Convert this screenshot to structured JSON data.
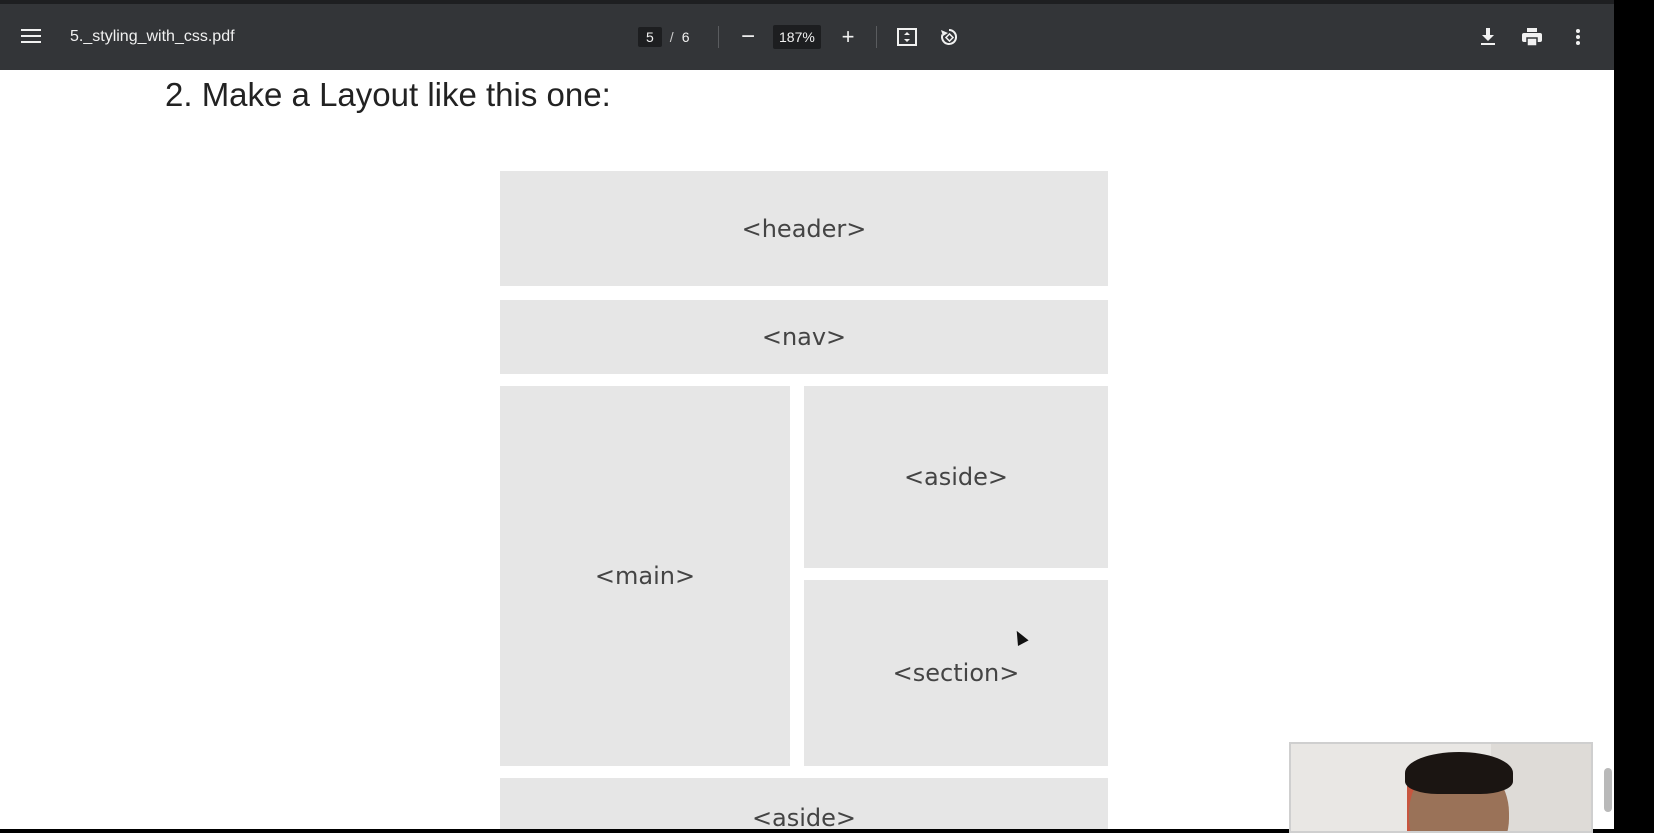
{
  "toolbar": {
    "file_name": "5._styling_with_css.pdf",
    "current_page": "5",
    "page_separator": "/",
    "total_pages": "6",
    "zoom_out_label": "−",
    "zoom_level": "187%",
    "zoom_in_label": "+",
    "icons": [
      "menu-icon",
      "fit-page-icon",
      "rotate-icon",
      "download-icon",
      "print-icon",
      "more-icon"
    ]
  },
  "document": {
    "heading": "2.  Make a Layout like this one:",
    "layout_boxes": {
      "header": "<header>",
      "nav": "<nav>",
      "main": "<main>",
      "aside_top": "<aside>",
      "section": "<section>",
      "aside_bottom": "<aside>"
    }
  },
  "colors": {
    "toolbar_bg": "#333538",
    "box_fill": "#e6e6e6",
    "page_bg": "#ffffff"
  }
}
